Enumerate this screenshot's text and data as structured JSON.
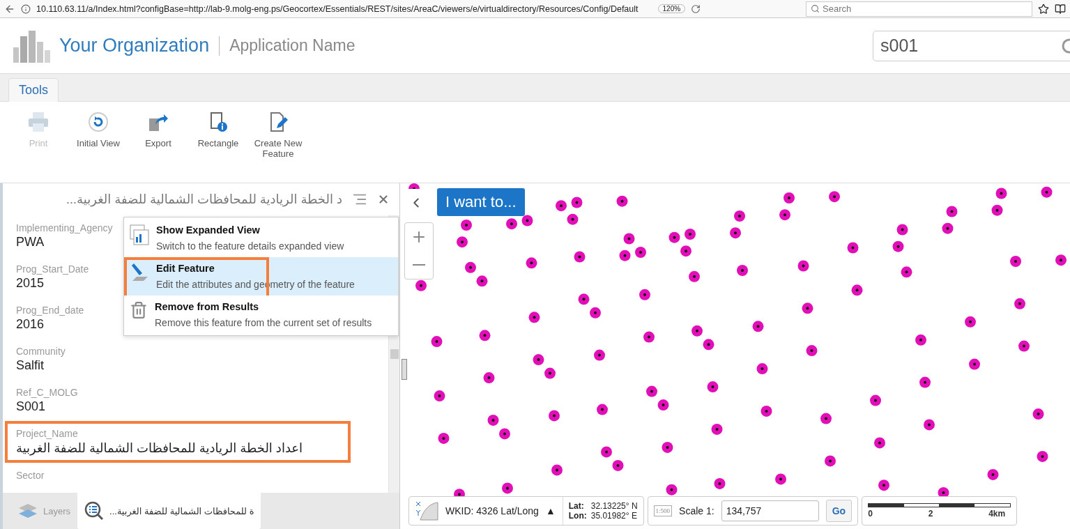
{
  "browser": {
    "url": "10.110.63.11/a/Index.html?configBase=http://lab-9.molg-eng.ps/Geocortex/Essentials/REST/sites/AreaC/viewers/e/virtualdirectory/Resources/Config/Default",
    "zoom": "120%",
    "search_placeholder": "Search"
  },
  "header": {
    "organization": "Your Organization",
    "application": "Application Name",
    "search_value": "s001"
  },
  "ribbon": {
    "tabs": [
      {
        "label": "Tools",
        "selected": true
      }
    ],
    "tools": [
      {
        "kind": "print",
        "label": "Print",
        "disabled": true
      },
      {
        "kind": "initial-view",
        "label": "Initial View",
        "disabled": false
      },
      {
        "kind": "export",
        "label": "Export",
        "disabled": false
      },
      {
        "kind": "rectangle",
        "label": "Rectangle",
        "disabled": false
      },
      {
        "kind": "create",
        "label": "Create New Feature",
        "disabled": false
      }
    ]
  },
  "panel": {
    "title": "...د الخطة الريادية للمحافظات الشمالية للضفة الغربية",
    "attributes": [
      {
        "label": "Implementing_Agency",
        "value": "PWA",
        "annotated": false
      },
      {
        "label": "Prog_Start_Date",
        "value": "2015",
        "annotated": false
      },
      {
        "label": "Prog_End_date",
        "value": "2016",
        "annotated": false
      },
      {
        "label": "Community",
        "value": "Salfit",
        "annotated": false
      },
      {
        "label": "Ref_C_MOLG",
        "value": "S001",
        "annotated": false
      },
      {
        "label": "Project_Name",
        "value": "اعداد الخطة الريادية للمحافظات الشمالية للضفة الغربية",
        "annotated": true
      },
      {
        "label": "Sector",
        "annotated": false
      }
    ],
    "menu": [
      {
        "kind": "expand",
        "title": "Show Expanded View",
        "description": "Switch to the feature details expanded view",
        "selected": false,
        "annotated": false
      },
      {
        "kind": "edit",
        "title": "Edit Feature",
        "description": "Edit the attributes and geometry of the feature",
        "selected": true,
        "annotated": true
      },
      {
        "kind": "remove",
        "title": "Remove from Results",
        "description": "Remove this feature from the current set of results",
        "selected": false,
        "annotated": false
      }
    ],
    "bottom_tabs": [
      {
        "kind": "layers",
        "label": "Layers",
        "selected": false
      },
      {
        "kind": "results",
        "label": "...ة للمحافظات الشمالية للضفة الغربية",
        "selected": true
      }
    ]
  },
  "map": {
    "action_button": "I want to...",
    "coordinates": {
      "wkid": "WKID: 4326 Lat/Long",
      "wkid_arrow": "▲",
      "lat_label": "Lat:",
      "lat": "32.13225° N",
      "lon_label": "Lon:",
      "lon": "35.01982° E"
    },
    "scale": {
      "icon_text": "1:500",
      "label": "Scale 1:",
      "value": "134,757",
      "button": "Go"
    },
    "scalebar": {
      "labels": [
        "0",
        "2",
        "4km"
      ]
    }
  }
}
